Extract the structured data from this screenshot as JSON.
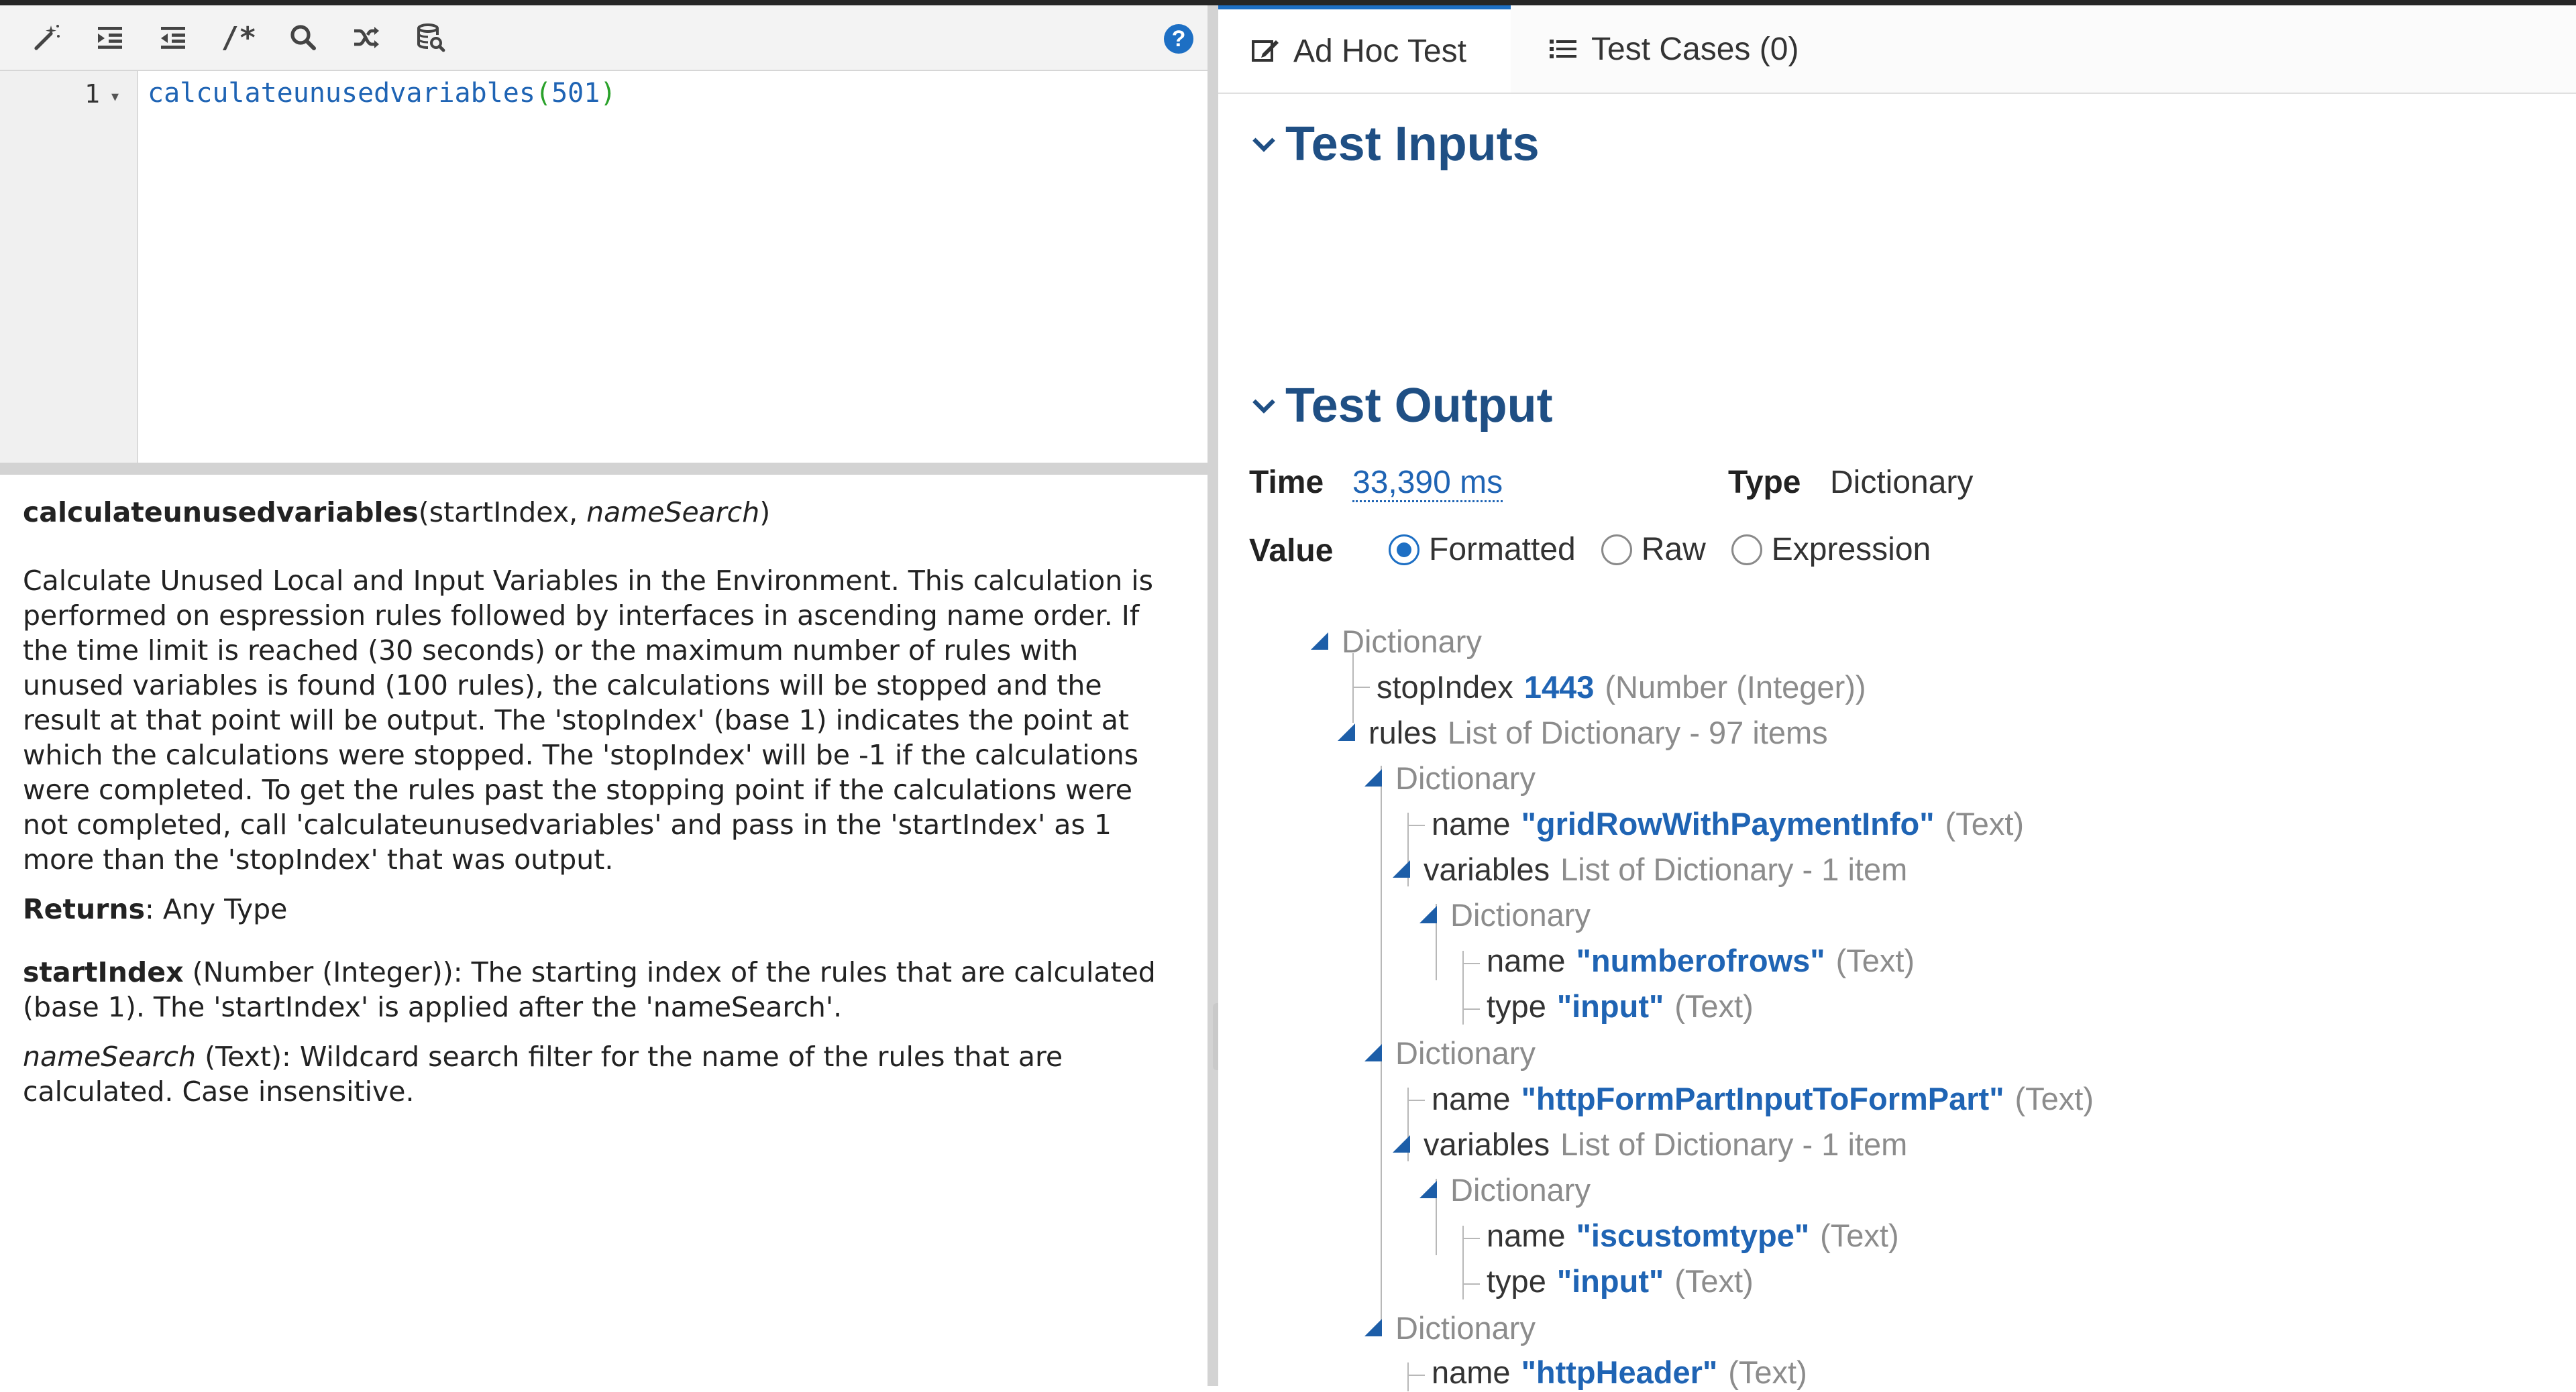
{
  "toolbar": {
    "icons": [
      "magic-wand-icon",
      "indent-icon",
      "outdent-icon",
      "comment-icon",
      "search-icon",
      "shuffle-icon",
      "database-search-icon"
    ],
    "comment_glyph": "/*",
    "help": "?"
  },
  "editor": {
    "line_number": "1",
    "fold_glyph": "▾",
    "code": {
      "fn": "calculateunusedvariables",
      "open": "(",
      "arg": "501",
      "close": ")"
    }
  },
  "doc": {
    "fn_name": "calculateunusedvariables",
    "sig_open": "(startIndex, ",
    "sig_opt": "nameSearch",
    "sig_close": ")",
    "description": "Calculate Unused Local and Input Variables in the Environment. This calculation is performed on espression rules followed by interfaces in ascending name order. If the time limit is reached (30 seconds) or the maximum number of rules with unused variables is found (100 rules), the calculations will be stopped and the result at that point will be output. The 'stopIndex' (base 1) indicates the point at which the calculations were stopped. The 'stopIndex' will be -1 if the calculations were completed. To get the rules past the stopping point if the calculations were not completed, call 'calculateunusedvariables' and pass in the 'startIndex' as 1 more than the 'stopIndex' that was output.",
    "returns_label": "Returns",
    "returns_value": ": Any Type",
    "param1_name": "startIndex",
    "param1_desc": " (Number (Integer)): The starting index of the rules that are calculated (base 1). The 'startIndex' is applied after the 'nameSearch'.",
    "param2_name": "nameSearch",
    "param2_desc": " (Text): Wildcard search filter for the name of the rules that are calculated. Case insensitive."
  },
  "divider": {
    "handle_glyph": "‹"
  },
  "tabs": [
    {
      "label": "Ad Hoc Test",
      "icon": "edit-icon",
      "active": true
    },
    {
      "label": "Test Cases (0)",
      "icon": "list-icon",
      "active": false
    }
  ],
  "test_inputs": {
    "title": "Test Inputs"
  },
  "test_output": {
    "title": "Test Output",
    "time_label": "Time",
    "time_value": "33,390 ms",
    "type_label": "Type",
    "type_value": "Dictionary",
    "value_label": "Value",
    "value_options": [
      "Formatted",
      "Raw",
      "Expression"
    ],
    "selected_option": "Formatted"
  },
  "tree": {
    "root_type": "Dictionary",
    "stop_key": "stopIndex",
    "stop_value": "1443",
    "stop_meta": "(Number (Integer))",
    "rules_key": "rules",
    "rules_meta": "List of Dictionary - 97 items",
    "dict_label": "Dictionary",
    "name_key": "name",
    "type_key": "type",
    "variables_key": "variables",
    "variables_meta": "List of Dictionary - 1 item",
    "text_meta": "(Text)",
    "items": [
      {
        "name": "\"gridRowWithPaymentInfo\"",
        "var_name": "\"numberofrows\"",
        "var_type": "\"input\""
      },
      {
        "name": "\"httpFormPartInputToFormPart\"",
        "var_name": "\"iscustomtype\"",
        "var_type": "\"input\""
      },
      {
        "name": "\"httpHeader\""
      }
    ]
  },
  "colors": {
    "accent": "#1d6fc4",
    "section_title": "#1f4f84",
    "value_blue": "#1f64b4",
    "meta_gray": "#8c8c8c",
    "code_green": "#2aa12a"
  }
}
